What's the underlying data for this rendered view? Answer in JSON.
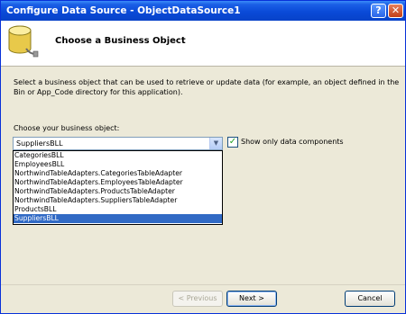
{
  "window": {
    "title": "Configure Data Source - ObjectDataSource1",
    "help_label": "?",
    "close_label": "✕"
  },
  "header": {
    "title": "Choose a Business Object"
  },
  "description": "Select a business object that can be used to retrieve or update data (for example, an object defined in the Bin or App_Code directory for this application).",
  "business_object": {
    "label": "Choose your business object:",
    "selected_value": "SuppliersBLL",
    "options": [
      "CategoriesBLL",
      "EmployeesBLL",
      "NorthwindTableAdapters.CategoriesTableAdapter",
      "NorthwindTableAdapters.EmployeesTableAdapter",
      "NorthwindTableAdapters.ProductsTableAdapter",
      "NorthwindTableAdapters.SuppliersTableAdapter",
      "ProductsBLL",
      "SuppliersBLL"
    ],
    "highlighted_option": "SuppliersBLL"
  },
  "show_only_data_components": {
    "label": "Show only data components",
    "checked": true
  },
  "buttons": {
    "previous_label": "< Previous",
    "next_label": "Next >",
    "cancel_label": "Cancel"
  },
  "icons": {
    "database": "database-icon",
    "dropdown_arrow": "chevron-down-icon",
    "checkmark": "checkmark-icon"
  }
}
